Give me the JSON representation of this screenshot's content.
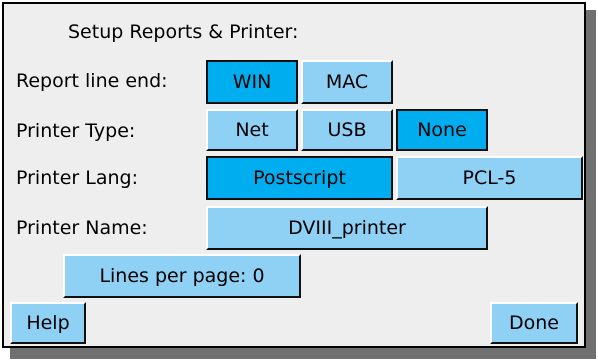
{
  "dialog": {
    "title": "Setup Reports & Printer:"
  },
  "report_line_end": {
    "label": "Report line end:",
    "options": [
      "WIN",
      "MAC"
    ],
    "selected": "WIN"
  },
  "printer_type": {
    "label": "Printer Type:",
    "options": [
      "Net",
      "USB",
      "None"
    ],
    "selected": "None"
  },
  "printer_lang": {
    "label": "Printer Lang:",
    "options": [
      "Postscript",
      "PCL-5"
    ],
    "selected": "Postscript"
  },
  "printer_name": {
    "label": "Printer Name:",
    "value": "DVIII_printer"
  },
  "lines_per_page": {
    "text": "Lines per page: 0"
  },
  "footer": {
    "help_label": "Help",
    "done_label": "Done"
  },
  "colors": {
    "selected": "#00aeef",
    "unselected": "#8fd0f5",
    "panel": "#eeeeee",
    "shadow": "#707070"
  }
}
